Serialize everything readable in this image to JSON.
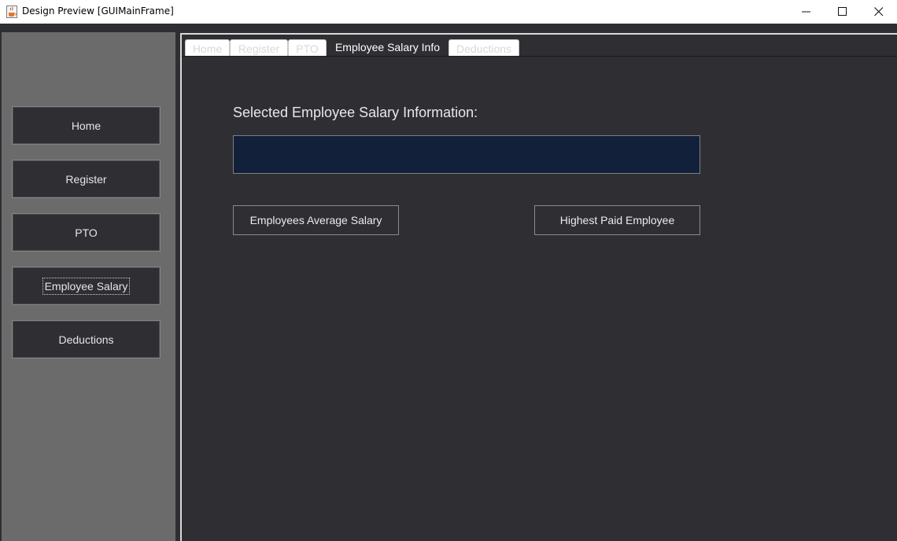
{
  "window": {
    "title": "Design Preview [GUIMainFrame]",
    "icon": "java-cup-icon",
    "controls": [
      "minimize-icon",
      "maximize-icon",
      "close-icon"
    ]
  },
  "sidebar": {
    "items": [
      {
        "label": "Home"
      },
      {
        "label": "Register"
      },
      {
        "label": "PTO"
      },
      {
        "label": "Employee Salary",
        "focused": true
      },
      {
        "label": "Deductions"
      }
    ]
  },
  "tabs": [
    {
      "label": "Home"
    },
    {
      "label": "Register"
    },
    {
      "label": "PTO"
    },
    {
      "label": "Employee Salary Info",
      "active": true
    },
    {
      "label": "Deductions"
    }
  ],
  "salary_panel": {
    "heading": "Selected Employee Salary Information:",
    "info_value": "",
    "average_button": "Employees Average Salary",
    "highest_button": "Highest Paid Employee"
  },
  "colors": {
    "background": "#2f2f33",
    "sidebar": "#6b6b6b",
    "field": "#13203a",
    "text": "#e6e6e6"
  }
}
